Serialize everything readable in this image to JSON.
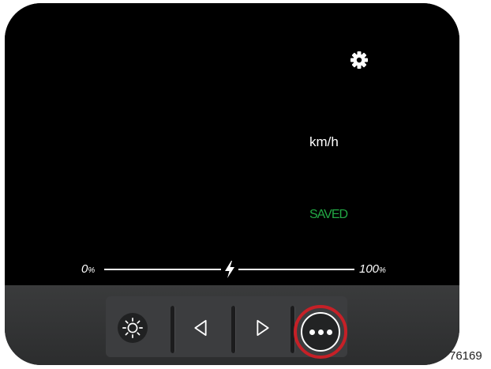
{
  "screen": {
    "settings_icon": "gear-icon",
    "speed_unit": "km/h",
    "status_text": "SAVED",
    "status_color": "#22a844"
  },
  "battery_bar": {
    "min_value": "0",
    "min_unit": "%",
    "max_value": "100",
    "max_unit": "%",
    "center_icon": "lightning-bolt-icon"
  },
  "toolbar": {
    "buttons": [
      {
        "icon": "brightness-icon"
      },
      {
        "icon": "triangle-left-icon"
      },
      {
        "icon": "triangle-right-icon"
      },
      {
        "icon": "more-options-icon",
        "highlight_color": "#c62027"
      }
    ]
  },
  "figure_number": "76169"
}
